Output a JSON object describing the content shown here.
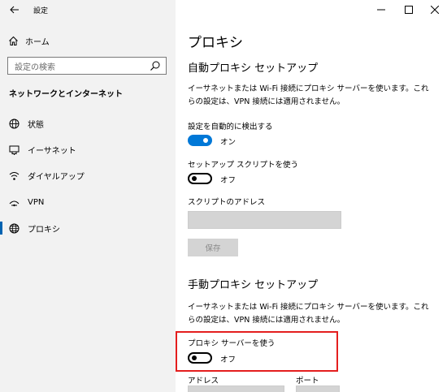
{
  "window": {
    "app_title": "設定"
  },
  "sidebar": {
    "home_label": "ホーム",
    "search_placeholder": "設定の検索",
    "section_title": "ネットワークとインターネット",
    "items": [
      {
        "label": "状態",
        "icon": "globe-status-icon"
      },
      {
        "label": "イーサネット",
        "icon": "ethernet-icon"
      },
      {
        "label": "ダイヤルアップ",
        "icon": "dialup-icon"
      },
      {
        "label": "VPN",
        "icon": "vpn-icon"
      },
      {
        "label": "プロキシ",
        "icon": "globe-icon",
        "selected": true
      }
    ]
  },
  "main": {
    "page_title": "プロキシ",
    "auto": {
      "heading": "自動プロキシ セットアップ",
      "description": "イーサネットまたは Wi-Fi 接続にプロキシ サーバーを使います。これらの設定は、VPN 接続には適用されません。",
      "detect_label": "設定を自動的に検出する",
      "detect_state": "オン",
      "script_label": "セットアップ スクリプトを使う",
      "script_state": "オフ",
      "address_label": "スクリプトのアドレス",
      "address_value": "",
      "save_label": "保存"
    },
    "manual": {
      "heading": "手動プロキシ セットアップ",
      "description": "イーサネットまたは Wi-Fi 接続にプロキシ サーバーを使います。これらの設定は、VPN 接続には適用されません。",
      "use_proxy_label": "プロキシ サーバーを使う",
      "use_proxy_state": "オフ",
      "address_col_label": "アドレス",
      "port_col_label": "ポート"
    }
  },
  "colors": {
    "accent": "#0078d7",
    "highlight_border": "#e41e1e",
    "sidebar_bg": "#f2f2f2"
  }
}
